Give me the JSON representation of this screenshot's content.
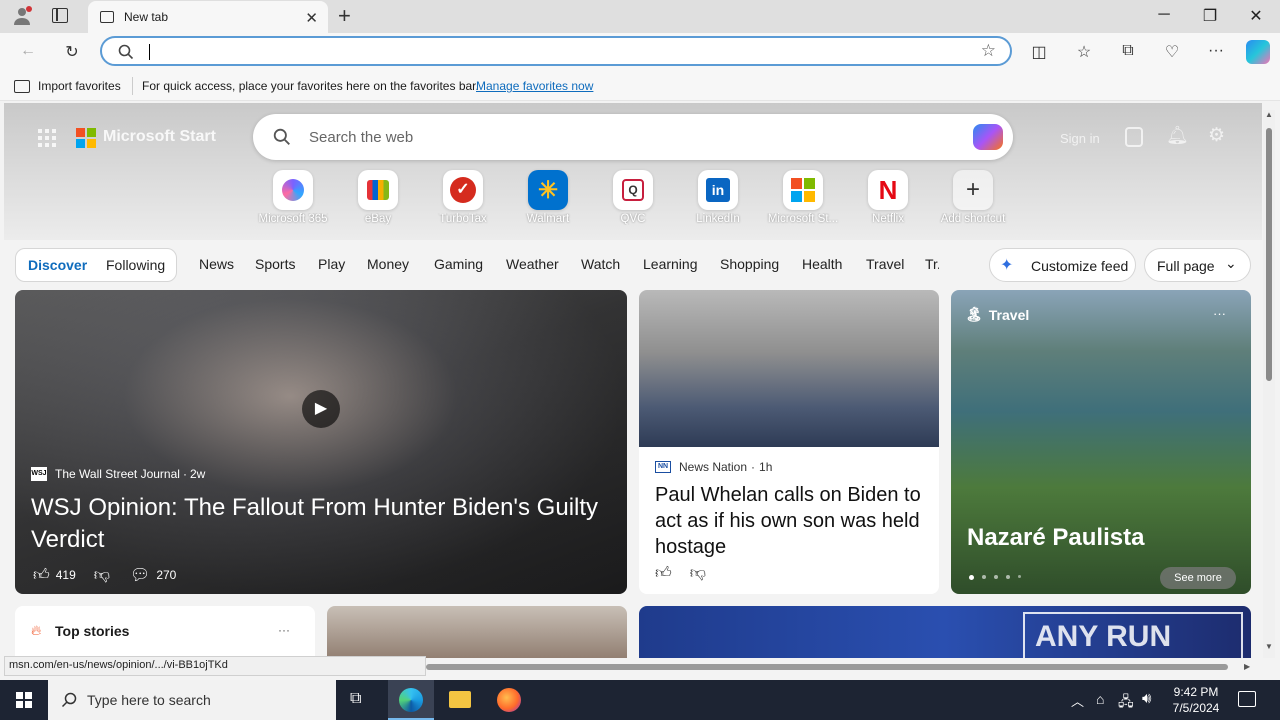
{
  "tab": {
    "title": "New tab"
  },
  "address": {
    "placeholder": ""
  },
  "favbar": {
    "import_label": "Import favorites",
    "hint": "For quick access, place your favorites here on the favorites bar.",
    "manage_link": "Manage favorites now"
  },
  "msn": {
    "brand": "Microsoft Start",
    "search_placeholder": "Search the web",
    "signin": "Sign in",
    "shortcuts": [
      {
        "label": "Microsoft 365",
        "icon": "m365-icon"
      },
      {
        "label": "eBay",
        "icon": "ebay-icon"
      },
      {
        "label": "TurboTax",
        "icon": "turbotax-icon"
      },
      {
        "label": "Walmart",
        "icon": "walmart-icon"
      },
      {
        "label": "QVC",
        "icon": "qvc-icon"
      },
      {
        "label": "LinkedIn",
        "icon": "linkedin-icon"
      },
      {
        "label": "Microsoft St...",
        "icon": "microsoft-store-icon"
      },
      {
        "label": "Netflix",
        "icon": "netflix-icon"
      },
      {
        "label": "Add shortcut",
        "icon": "plus-icon"
      }
    ],
    "nav": {
      "discover": "Discover",
      "following": "Following",
      "items": [
        "News",
        "Sports",
        "Play",
        "Money",
        "Gaming",
        "Weather",
        "Watch",
        "Learning",
        "Shopping",
        "Health",
        "Travel",
        "Tr..."
      ],
      "customize": "Customize feed",
      "layout": "Full page"
    },
    "main_card": {
      "source": "The Wall Street Journal",
      "source_abbr": "WSJ",
      "age": "2w",
      "headline": "WSJ Opinion: The Fallout From Hunter Biden's Guilty Verdict",
      "likes": "419",
      "comments": "270"
    },
    "news_card": {
      "source": "News Nation",
      "source_abbr": "NN",
      "age": "1h",
      "headline": "Paul Whelan calls on Biden to act as if his own son was held hostage"
    },
    "travel_card": {
      "category": "Travel",
      "title": "Nazaré Paulista",
      "see_more": "See more",
      "more": "···"
    },
    "top_stories": {
      "label": "Top stories",
      "more": "···"
    }
  },
  "status_url": "msn.com/en-us/news/opinion/.../vi-BB1ojTKd",
  "taskbar": {
    "search_placeholder": "Type here to search",
    "time": "9:42 PM",
    "date": "7/5/2024"
  },
  "watermark": "ANY RUN",
  "colors": {
    "accent": "#0f6cbd",
    "taskbar": "#1d2433",
    "address_border": "#5b9bd5"
  }
}
